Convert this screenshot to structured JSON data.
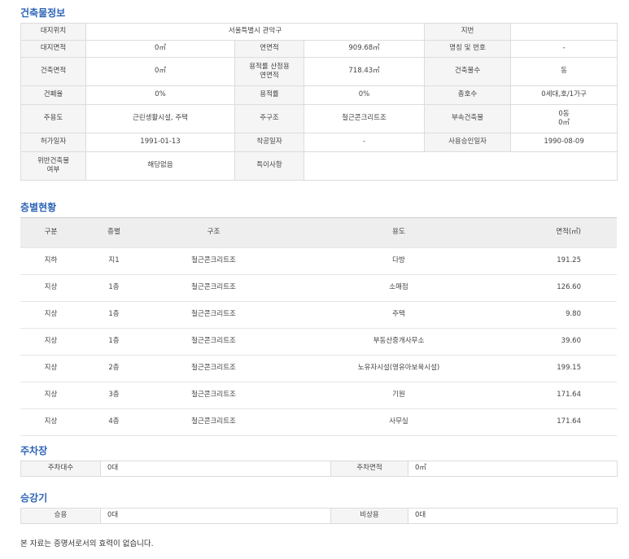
{
  "sections": {
    "building_info": "건축물정보",
    "floor_status": "층별현황",
    "parking": "주차장",
    "elevator": "승강기"
  },
  "info": {
    "site_location_label": "대지위치",
    "site_location": "서울특별시 관악구",
    "lot_label": "지번",
    "lot": "",
    "site_area_label": "대지면적",
    "site_area": "0㎡",
    "total_floor_area_label": "연면적",
    "total_floor_area": "909.68㎡",
    "name_number_label": "명칭 및 번호",
    "name_number": "-",
    "building_area_label": "건축면적",
    "building_area": "0㎡",
    "far_area_label_1": "용적률 산정용",
    "far_area_label_2": "연면적",
    "far_area": "718.43㎡",
    "building_count_label": "건축물수",
    "building_count": "동",
    "coverage_label": "건폐율",
    "coverage": "0%",
    "far_label": "용적률",
    "far": "0%",
    "households_label": "총호수",
    "households": "0세대,호/1가구",
    "main_use_label": "주용도",
    "main_use": "근린생활시설, 주택",
    "main_structure_label": "주구조",
    "main_structure": "철근콘크리트조",
    "annex_label": "부속건축물",
    "annex_count": "0동",
    "annex_area": "0㎡",
    "permit_date_label": "허가일자",
    "permit_date": "1991-01-13",
    "start_date_label": "착공일자",
    "start_date": "-",
    "approval_date_label": "사용승인일자",
    "approval_date": "1990-08-09",
    "violation_label_1": "위반건축물",
    "violation_label_2": "여부",
    "violation": "해당없음",
    "special_label": "특이사항",
    "special": ""
  },
  "floors": {
    "headers": [
      "구분",
      "층별",
      "구조",
      "용도",
      "면적(㎡)"
    ],
    "rows": [
      [
        "지하",
        "지1",
        "철근콘크리트조",
        "다방",
        "191.25"
      ],
      [
        "지상",
        "1층",
        "철근콘크리트조",
        "소매점",
        "126.60"
      ],
      [
        "지상",
        "1층",
        "철근콘크리트조",
        "주택",
        "9.80"
      ],
      [
        "지상",
        "1층",
        "철근콘크리트조",
        "부동산중개사무소",
        "39.60"
      ],
      [
        "지상",
        "2층",
        "철근콘크리트조",
        "노유자시설(영유아보육시설)",
        "199.15"
      ],
      [
        "지상",
        "3층",
        "철근콘크리트조",
        "기원",
        "171.64"
      ],
      [
        "지상",
        "4층",
        "철근콘크리트조",
        "사무실",
        "171.64"
      ]
    ]
  },
  "parking": {
    "count_label": "주차대수",
    "count": "0대",
    "area_label": "주차면적",
    "area": "0㎡"
  },
  "elevator": {
    "passenger_label": "승용",
    "passenger": "0대",
    "emergency_label": "비상용",
    "emergency": "0대"
  },
  "note": "본 자료는 증명서로서의 효력이 없습니다."
}
